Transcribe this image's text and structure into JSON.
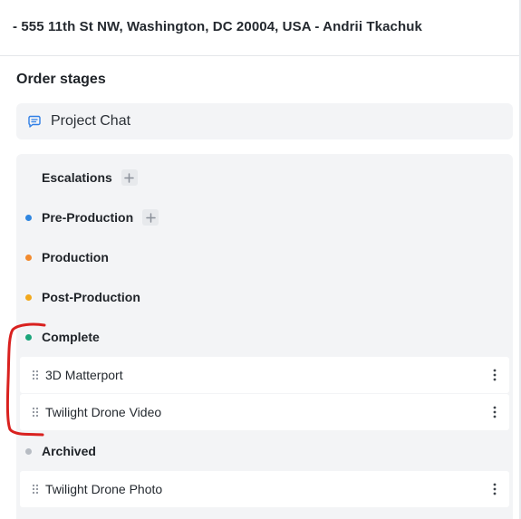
{
  "header": {
    "address": "- 555 11th St NW, Washington, DC 20004, USA - Andrii Tkachuk"
  },
  "section": {
    "title": "Order stages"
  },
  "chat": {
    "label": "Project Chat",
    "icon": "chat-bubble-icon",
    "icon_color": "#2f7fe6"
  },
  "stages": [
    {
      "name": "Escalations",
      "dot_color": null,
      "has_add": true
    },
    {
      "name": "Pre-Production",
      "dot_color": "#2f86e0",
      "has_add": true
    },
    {
      "name": "Production",
      "dot_color": "#f28a2e",
      "has_add": false
    },
    {
      "name": "Post-Production",
      "dot_color": "#f2a81c",
      "has_add": false
    },
    {
      "name": "Complete",
      "dot_color": "#1ba57a",
      "has_add": false,
      "items": [
        "3D Matterport",
        "Twilight Drone Video"
      ]
    },
    {
      "name": "Archived",
      "dot_color": "#b7bcc3",
      "has_add": false,
      "items": [
        "Twilight Drone Photo"
      ]
    }
  ],
  "colors": {
    "panel_bg": "#f3f4f6",
    "annotation_red": "#d9211f"
  },
  "icons": {
    "add": "plus-icon",
    "drag": "drag-handle-icon",
    "menu": "kebab-menu-icon"
  }
}
